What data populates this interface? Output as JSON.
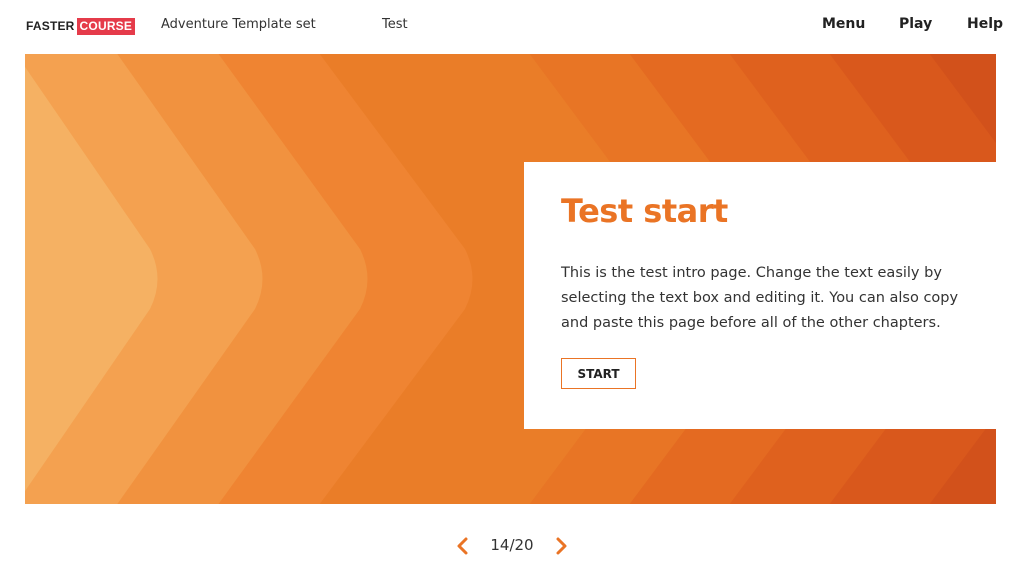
{
  "header": {
    "logo_part1": "FASTER",
    "logo_part2": "COURSE",
    "course_title": "Adventure Template set",
    "chapter_title": "Test",
    "nav": {
      "menu": "Menu",
      "play": "Play",
      "help": "Help"
    }
  },
  "card": {
    "title": "Test start",
    "body": "This is the test intro page. Change the text easily by selecting the text box and editing it. You can also copy and paste this page before all of the other chapters.",
    "start_label": "START"
  },
  "pager": {
    "current": 14,
    "total": 20,
    "label": "14/20",
    "prev_icon": "chevron-left-icon",
    "next_icon": "chevron-right-icon"
  },
  "colors": {
    "accent": "#ea7425",
    "logo_red": "#e53b4a",
    "hero_dark": "#c84a1a",
    "hero_light": "#f5b163"
  }
}
